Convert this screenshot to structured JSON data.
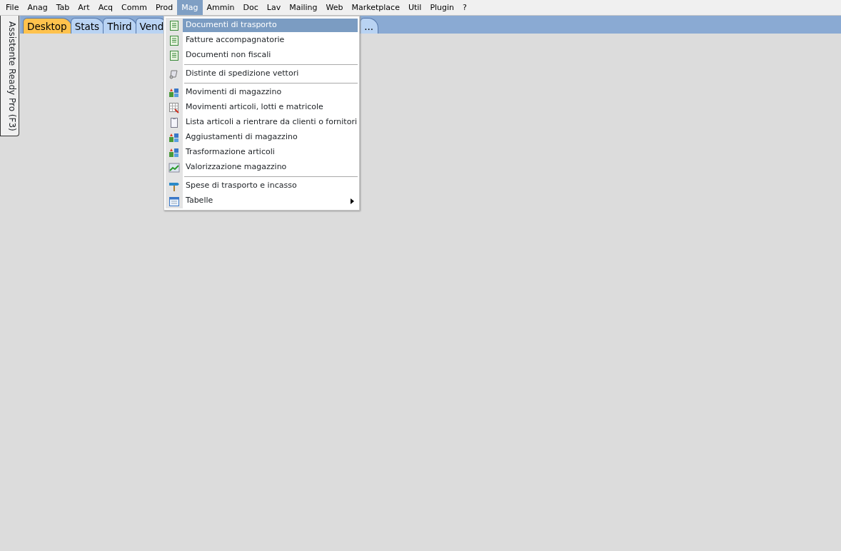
{
  "menu_bar": [
    {
      "label": "File",
      "selected": false
    },
    {
      "label": "Anag",
      "selected": false
    },
    {
      "label": "Tab",
      "selected": false
    },
    {
      "label": "Art",
      "selected": false
    },
    {
      "label": "Acq",
      "selected": false
    },
    {
      "label": "Comm",
      "selected": false
    },
    {
      "label": "Prod",
      "selected": false
    },
    {
      "label": "Mag",
      "selected": true
    },
    {
      "label": "Ammin",
      "selected": false
    },
    {
      "label": "Doc",
      "selected": false
    },
    {
      "label": "Lav",
      "selected": false
    },
    {
      "label": "Mailing",
      "selected": false
    },
    {
      "label": "Web",
      "selected": false
    },
    {
      "label": "Marketplace",
      "selected": false
    },
    {
      "label": "Util",
      "selected": false
    },
    {
      "label": "Plugin",
      "selected": false
    },
    {
      "label": "?",
      "selected": false
    }
  ],
  "side_tab": {
    "label": "Assistente Ready Pro (F3)"
  },
  "tabs": [
    {
      "label": "Desktop",
      "selected": true
    },
    {
      "label": "Stats",
      "selected": false
    },
    {
      "label": "Third",
      "selected": false
    },
    {
      "label": "Vend",
      "selected": false
    },
    {
      "label": "...",
      "selected": false
    }
  ],
  "dropdown": {
    "items": [
      {
        "kind": "item",
        "label": "Documenti di trasporto",
        "selected": true,
        "submenu": false
      },
      {
        "kind": "item",
        "label": "Fatture accompagnatorie",
        "selected": false,
        "submenu": false
      },
      {
        "kind": "item",
        "label": "Documenti non fiscali",
        "selected": false,
        "submenu": false
      },
      {
        "kind": "separator"
      },
      {
        "kind": "item",
        "label": "Distinte di spedizione vettori",
        "selected": false,
        "submenu": false
      },
      {
        "kind": "separator"
      },
      {
        "kind": "item",
        "label": "Movimenti di magazzino",
        "selected": false,
        "submenu": false
      },
      {
        "kind": "item",
        "label": "Movimenti articoli, lotti e matricole",
        "selected": false,
        "submenu": false
      },
      {
        "kind": "item",
        "label": "Lista articoli a rientrare da clienti o fornitori",
        "selected": false,
        "submenu": false
      },
      {
        "kind": "item",
        "label": "Aggiustamenti di magazzino",
        "selected": false,
        "submenu": false
      },
      {
        "kind": "item",
        "label": "Trasformazione articoli",
        "selected": false,
        "submenu": false
      },
      {
        "kind": "item",
        "label": "Valorizzazione magazzino",
        "selected": false,
        "submenu": false
      },
      {
        "kind": "separator"
      },
      {
        "kind": "item",
        "label": "Spese di trasporto e incasso",
        "selected": false,
        "submenu": false
      },
      {
        "kind": "item",
        "label": "Tabelle",
        "selected": false,
        "submenu": true
      }
    ]
  }
}
